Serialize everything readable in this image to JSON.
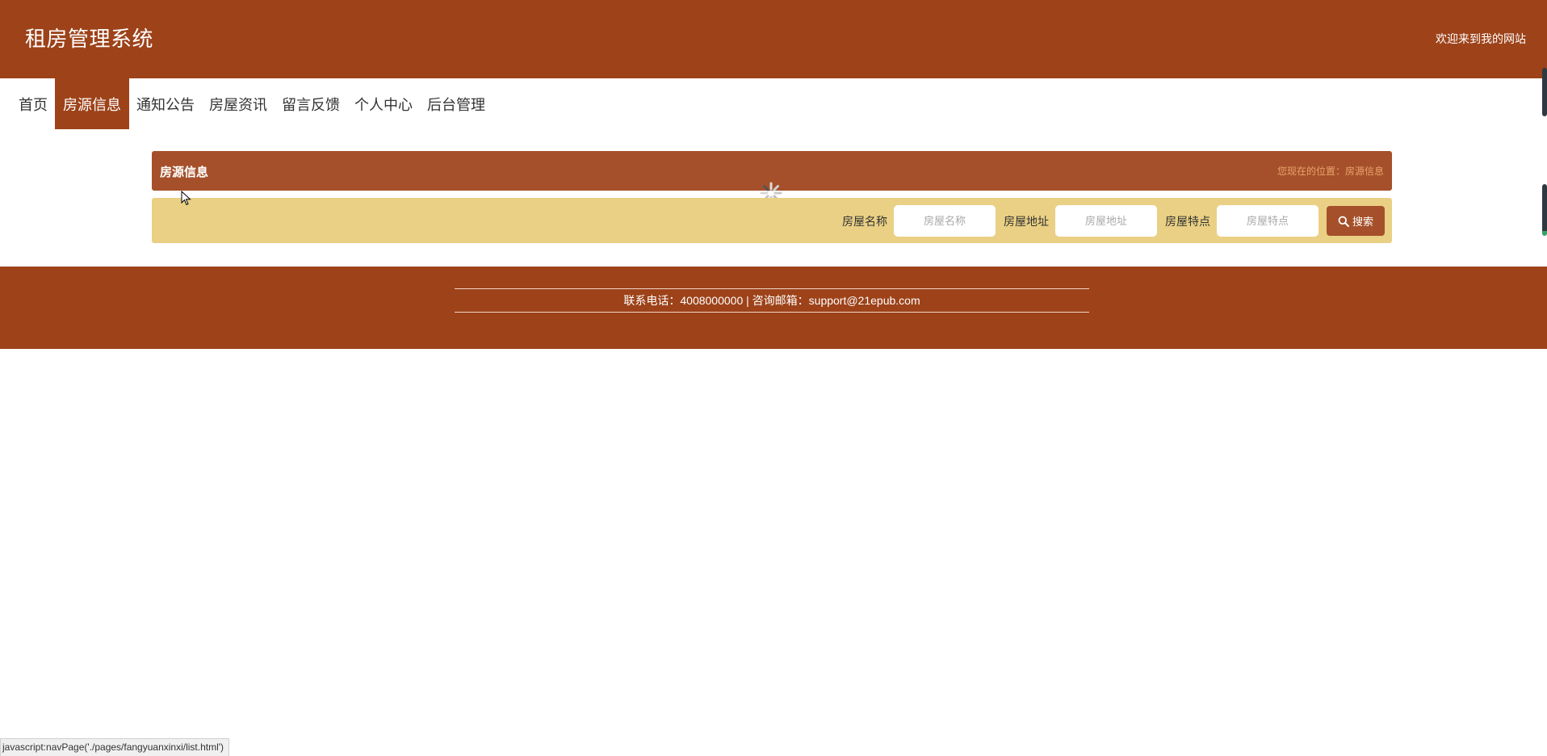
{
  "header": {
    "title": "租房管理系统",
    "welcome": "欢迎来到我的网站"
  },
  "nav": {
    "items": [
      {
        "label": "首页"
      },
      {
        "label": "房源信息",
        "active": true
      },
      {
        "label": "通知公告"
      },
      {
        "label": "房屋资讯"
      },
      {
        "label": "留言反馈"
      },
      {
        "label": "个人中心"
      },
      {
        "label": "后台管理"
      }
    ]
  },
  "section": {
    "title": "房源信息",
    "breadcrumb": "您现在的位置：房源信息"
  },
  "filters": {
    "name_label": "房屋名称",
    "name_placeholder": "房屋名称",
    "address_label": "房屋地址",
    "address_placeholder": "房屋地址",
    "feature_label": "房屋特点",
    "feature_placeholder": "房屋特点",
    "search_label": "搜索"
  },
  "footer": {
    "contact": "联系电话：4008000000 | 咨询邮箱：support@21epub.com"
  },
  "status_bar": {
    "text": "javascript:navPage('./pages/fangyuanxinxi/list.html')"
  },
  "colors": {
    "brand": "#9d4219",
    "section_header": "#a5502a",
    "filter_bg": "#ead084",
    "breadcrumb": "#e8a36b"
  },
  "icons": {
    "search": "search-icon",
    "spinner": "loading-spinner-icon",
    "cursor": "mouse-cursor-icon"
  }
}
